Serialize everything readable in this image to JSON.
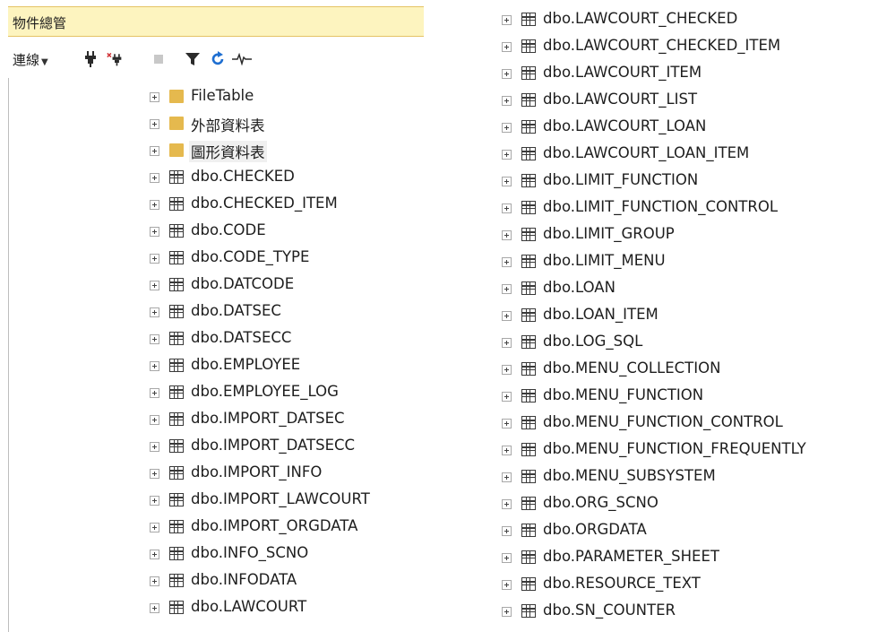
{
  "panel": {
    "title": "物件總管"
  },
  "toolbar": {
    "connect_label": "連線",
    "buttons": [
      {
        "icon": "plug-icon"
      },
      {
        "icon": "disconnect-icon"
      },
      {
        "icon": "stop-icon"
      },
      {
        "icon": "filter-icon"
      },
      {
        "icon": "refresh-icon"
      },
      {
        "icon": "activity-icon"
      }
    ]
  },
  "colors": {
    "title_bg": "#fdf4bf",
    "title_border": "#e5c365",
    "folder": "#e5b94e"
  },
  "tree_left": [
    {
      "label": "FileTable",
      "icon": "folder-icon"
    },
    {
      "label": "外部資料表",
      "icon": "folder-icon"
    },
    {
      "label": "圖形資料表",
      "icon": "folder-icon",
      "selected": true
    },
    {
      "label": "dbo.CHECKED",
      "icon": "table-icon"
    },
    {
      "label": "dbo.CHECKED_ITEM",
      "icon": "table-icon"
    },
    {
      "label": "dbo.CODE",
      "icon": "table-icon"
    },
    {
      "label": "dbo.CODE_TYPE",
      "icon": "table-icon"
    },
    {
      "label": "dbo.DATCODE",
      "icon": "table-icon"
    },
    {
      "label": "dbo.DATSEC",
      "icon": "table-icon"
    },
    {
      "label": "dbo.DATSECC",
      "icon": "table-icon"
    },
    {
      "label": "dbo.EMPLOYEE",
      "icon": "table-icon"
    },
    {
      "label": "dbo.EMPLOYEE_LOG",
      "icon": "table-icon"
    },
    {
      "label": "dbo.IMPORT_DATSEC",
      "icon": "table-icon"
    },
    {
      "label": "dbo.IMPORT_DATSECC",
      "icon": "table-icon"
    },
    {
      "label": "dbo.IMPORT_INFO",
      "icon": "table-icon"
    },
    {
      "label": "dbo.IMPORT_LAWCOURT",
      "icon": "table-icon"
    },
    {
      "label": "dbo.IMPORT_ORGDATA",
      "icon": "table-icon"
    },
    {
      "label": "dbo.INFO_SCNO",
      "icon": "table-icon"
    },
    {
      "label": "dbo.INFODATA",
      "icon": "table-icon"
    },
    {
      "label": "dbo.LAWCOURT",
      "icon": "table-icon"
    }
  ],
  "tree_right": [
    {
      "label": "dbo.LAWCOURT_CHECKED",
      "icon": "table-icon"
    },
    {
      "label": "dbo.LAWCOURT_CHECKED_ITEM",
      "icon": "table-icon"
    },
    {
      "label": "dbo.LAWCOURT_ITEM",
      "icon": "table-icon"
    },
    {
      "label": "dbo.LAWCOURT_LIST",
      "icon": "table-icon"
    },
    {
      "label": "dbo.LAWCOURT_LOAN",
      "icon": "table-icon"
    },
    {
      "label": "dbo.LAWCOURT_LOAN_ITEM",
      "icon": "table-icon"
    },
    {
      "label": "dbo.LIMIT_FUNCTION",
      "icon": "table-icon"
    },
    {
      "label": "dbo.LIMIT_FUNCTION_CONTROL",
      "icon": "table-icon"
    },
    {
      "label": "dbo.LIMIT_GROUP",
      "icon": "table-icon"
    },
    {
      "label": "dbo.LIMIT_MENU",
      "icon": "table-icon"
    },
    {
      "label": "dbo.LOAN",
      "icon": "table-icon"
    },
    {
      "label": "dbo.LOAN_ITEM",
      "icon": "table-icon"
    },
    {
      "label": "dbo.LOG_SQL",
      "icon": "table-icon"
    },
    {
      "label": "dbo.MENU_COLLECTION",
      "icon": "table-icon"
    },
    {
      "label": "dbo.MENU_FUNCTION",
      "icon": "table-icon"
    },
    {
      "label": "dbo.MENU_FUNCTION_CONTROL",
      "icon": "table-icon"
    },
    {
      "label": "dbo.MENU_FUNCTION_FREQUENTLY",
      "icon": "table-icon"
    },
    {
      "label": "dbo.MENU_SUBSYSTEM",
      "icon": "table-icon"
    },
    {
      "label": "dbo.ORG_SCNO",
      "icon": "table-icon"
    },
    {
      "label": "dbo.ORGDATA",
      "icon": "table-icon"
    },
    {
      "label": "dbo.PARAMETER_SHEET",
      "icon": "table-icon"
    },
    {
      "label": "dbo.RESOURCE_TEXT",
      "icon": "table-icon"
    },
    {
      "label": "dbo.SN_COUNTER",
      "icon": "table-icon"
    }
  ]
}
